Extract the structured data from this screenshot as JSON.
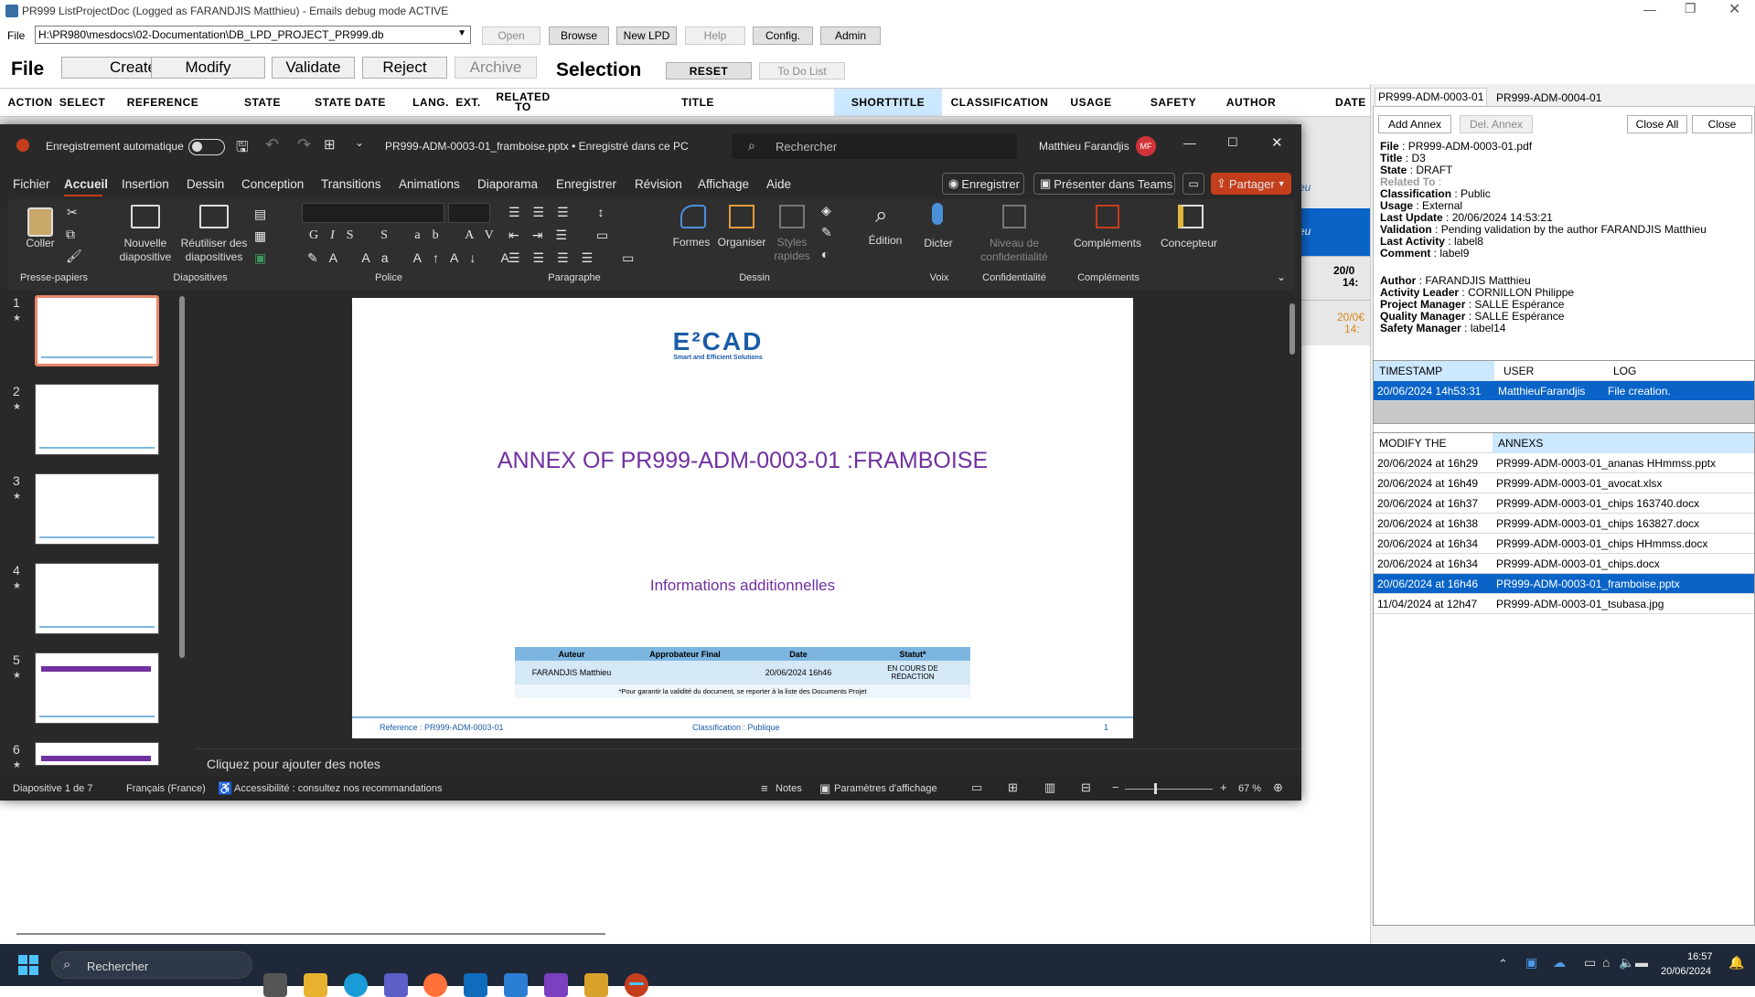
{
  "window": {
    "title": "PR999 ListProjectDoc (Logged as FARANDJIS Matthieu) - Emails debug mode ACTIVE"
  },
  "toolbar": {
    "file_label": "File",
    "path_value": "H:\\PR980\\mesdocs\\02-Documentation\\DB_LPD_PROJECT_PR999.db",
    "open": "Open",
    "browse": "Browse",
    "new_lpd": "New LPD",
    "help": "Help",
    "config": "Config.",
    "admin": "Admin"
  },
  "actions": {
    "file": "File",
    "create": "Create",
    "modify": "Modify",
    "validate": "Validate",
    "reject": "Reject",
    "archive": "Archive",
    "selection": "Selection",
    "reset": "RESET",
    "todo": "To Do List"
  },
  "columns": [
    "ACTION",
    "SELECT",
    "REFERENCE",
    "STATE",
    "STATE DATE",
    "LANG.",
    "EXT.",
    "RELATED TO",
    "TITLE",
    "SHORTTITLE",
    "CLASSIFICATION",
    "USAGE",
    "SAFETY",
    "AUTHOR",
    "DATE"
  ],
  "grid_fragments": {
    "eu1": "eu",
    "eu2": "eu",
    "date1": "20/0€",
    "time1": "14:",
    "date2": "20/0",
    "time2": "14:"
  },
  "side": {
    "tabs": [
      "PR999-ADM-0003-01",
      "PR999-ADM-0004-01"
    ],
    "buttons": {
      "add_annex": "Add Annex",
      "del_annex": "Del. Annex",
      "close_all": "Close All",
      "close": "Close"
    },
    "fields": [
      {
        "key": "File",
        "value": "PR999-ADM-0003-01.pdf"
      },
      {
        "key": "Title",
        "value": "D3"
      },
      {
        "key": "State",
        "value": "DRAFT"
      },
      {
        "key": "Related To",
        "value": ""
      },
      {
        "key": "Classification",
        "value": "Public"
      },
      {
        "key": "Usage",
        "value": "External"
      },
      {
        "key": "Last Update",
        "value": "20/06/2024 14:53:21"
      },
      {
        "key": "Validation",
        "value": "Pending validation by the author FARANDJIS Matthieu"
      },
      {
        "key": "Last Activity",
        "value": "label8"
      },
      {
        "key": "Comment",
        "value": "label9"
      }
    ],
    "people": [
      {
        "key": "Author",
        "value": "FARANDJIS Matthieu"
      },
      {
        "key": "Activity Leader",
        "value": "CORNILLON Philippe"
      },
      {
        "key": "Project Manager",
        "value": "SALLE Espérance"
      },
      {
        "key": "Quality Manager",
        "value": "SALLE Espérance"
      },
      {
        "key": "Safety Manager",
        "value": "label14"
      }
    ],
    "log_headers": [
      "TIMESTAMP",
      "USER",
      "LOG"
    ],
    "log_rows": [
      [
        "20/06/2024 14h53:31",
        "MatthieuFarandjis",
        "File creation."
      ]
    ],
    "annex_headers": [
      "MODIFY THE",
      "ANNEXS"
    ],
    "annex_rows": [
      [
        "20/06/2024 at 16h29",
        "PR999-ADM-0003-01_ananas HHmmss.pptx"
      ],
      [
        "20/06/2024 at 16h49",
        "PR999-ADM-0003-01_avocat.xlsx"
      ],
      [
        "20/06/2024 at 16h37",
        "PR999-ADM-0003-01_chips 163740.docx"
      ],
      [
        "20/06/2024 at 16h38",
        "PR999-ADM-0003-01_chips 163827.docx"
      ],
      [
        "20/06/2024 at 16h34",
        "PR999-ADM-0003-01_chips HHmmss.docx"
      ],
      [
        "20/06/2024 at 16h34",
        "PR999-ADM-0003-01_chips.docx"
      ],
      [
        "20/06/2024 at 16h46",
        "PR999-ADM-0003-01_framboise.pptx"
      ],
      [
        "11/04/2024 at 12h47",
        "PR999-ADM-0003-01_tsubasa.jpg"
      ]
    ],
    "annex_selected_index": 6
  },
  "ppt": {
    "autosave": "Enregistrement automatique",
    "filename": "PR999-ADM-0003-01_framboise.pptx • Enregistré dans ce PC",
    "search": "Rechercher",
    "user": "Matthieu Farandjis",
    "initials": "MF",
    "menu": [
      "Fichier",
      "Accueil",
      "Insertion",
      "Dessin",
      "Conception",
      "Transitions",
      "Animations",
      "Diaporama",
      "Enregistrer",
      "Révision",
      "Affichage",
      "Aide"
    ],
    "enregistrer_btn": "Enregistrer",
    "teams_btn": "Présenter dans Teams",
    "share_btn": "Partager",
    "ribbon": {
      "coller": "Coller",
      "nouvelle": "Nouvelle diapositive",
      "reutiliser": "Réutiliser des diapositives",
      "formes": "Formes",
      "organiser": "Organiser",
      "styles": "Styles rapides",
      "edition": "Édition",
      "dicter": "Dicter",
      "niveau": "Niveau de confidentialité",
      "complements": "Compléments",
      "concepteur": "Concepteur"
    },
    "groups": [
      "Presse-papiers",
      "Diapositives",
      "Police",
      "Paragraphe",
      "Dessin",
      "Voix",
      "Confidentialité",
      "Compléments"
    ],
    "slide_numbers": [
      "1",
      "2",
      "3",
      "4",
      "5",
      "6"
    ],
    "slide": {
      "logo_main": "E²CAD",
      "logo_sub": "Smart and Efficient Solutions",
      "title": "ANNEX OF PR999-ADM-0003-01 :FRAMBOISE",
      "subtitle": "Informations additionnelles",
      "table_headers": [
        "Auteur",
        "Approbateur Final",
        "Date",
        "Statut*"
      ],
      "table_row": [
        "FARANDJIS Matthieu",
        "",
        "20/06/2024 16h46",
        "EN COURS DE RÉDACTION"
      ],
      "footnote": "*Pour garantir la validité du document, se reporter à la liste des Documents Projet",
      "footer_ref": "Reference : PR999-ADM-0003-01",
      "footer_class": "Classification : Publique",
      "footer_page": "1"
    },
    "notes": "Cliquez pour ajouter des notes",
    "status": {
      "slide": "Diapositive 1 de 7",
      "lang": "Français (France)",
      "access": "Accessibilité : consultez nos recommandations",
      "notes": "Notes",
      "display": "Paramètres d'affichage",
      "zoom": "67 %"
    }
  },
  "taskbar": {
    "search": "Rechercher",
    "time": "16:57",
    "date": "20/06/2024"
  },
  "colors": {
    "accent": "#0a64c8",
    "ppt_red": "#c43e1c",
    "slide_purple": "#7030a0",
    "header_blue": "#cce8ff"
  }
}
